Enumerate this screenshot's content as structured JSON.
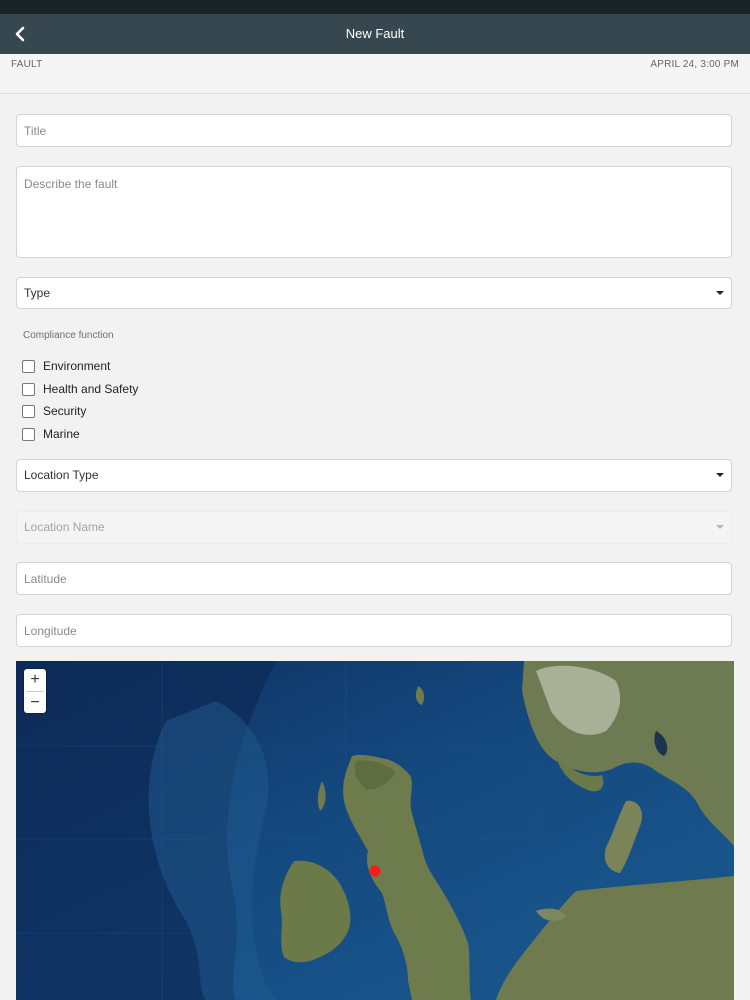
{
  "header": {
    "title": "New Fault",
    "back_icon": "chevron-left-icon"
  },
  "subheader": {
    "category": "FAULT",
    "datetime": "APRIL 24, 3:00 PM"
  },
  "form": {
    "title_placeholder": "Title",
    "description_placeholder": "Describe the fault",
    "type_label": "Type",
    "compliance_label": "Compliance function",
    "compliance_options": [
      {
        "label": "Environment",
        "checked": false
      },
      {
        "label": "Health and Safety",
        "checked": false
      },
      {
        "label": "Security",
        "checked": false
      },
      {
        "label": "Marine",
        "checked": false
      }
    ],
    "location_type_label": "Location Type",
    "location_name_label": "Location Name",
    "location_name_disabled": true,
    "latitude_placeholder": "Latitude",
    "longitude_placeholder": "Longitude"
  },
  "map": {
    "zoom_in_label": "+",
    "zoom_out_label": "−",
    "marker_color": "#ff1a1a",
    "tile_style": "satellite"
  },
  "colors": {
    "navbar": "#37474f",
    "ocean": "#0f3f77",
    "land": "#6b7a4a"
  }
}
